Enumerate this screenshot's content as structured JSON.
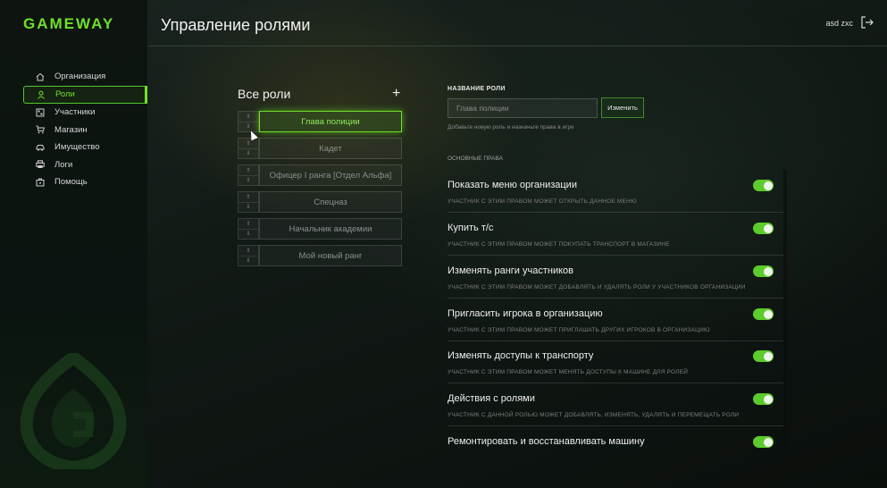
{
  "brand": {
    "logo_text": "GAMEWAY",
    "accent": "#6fe02a"
  },
  "header": {
    "title": "Управление ролями",
    "username": "asd zxc",
    "logout_icon": "logout-icon"
  },
  "sidebar": {
    "items": [
      {
        "label": "Организация",
        "icon": "home-icon",
        "active": false
      },
      {
        "label": "Роли",
        "icon": "user-icon",
        "active": true
      },
      {
        "label": "Участники",
        "icon": "members-icon",
        "active": false
      },
      {
        "label": "Магазин",
        "icon": "cart-icon",
        "active": false
      },
      {
        "label": "Имущество",
        "icon": "car-icon",
        "active": false
      },
      {
        "label": "Логи",
        "icon": "printer-icon",
        "active": false
      },
      {
        "label": "Помощь",
        "icon": "help-icon",
        "active": false
      }
    ]
  },
  "roles": {
    "title": "Все роли",
    "add_label": "+",
    "items": [
      {
        "name": "Глава полиции",
        "active": true
      },
      {
        "name": "Кадет",
        "active": false
      },
      {
        "name": "Офицер I ранга [Отдел Альфа]",
        "active": false
      },
      {
        "name": "Спецназ",
        "active": false
      },
      {
        "name": "Начальник академии",
        "active": false
      },
      {
        "name": "Мой новый ранг",
        "active": false
      }
    ]
  },
  "editor": {
    "name_label": "НАЗВАНИЕ РОЛИ",
    "name_placeholder": "Глава полиции",
    "change_label": "Изменить",
    "hint": "Добавьте новую роль и назначьте права в игре",
    "section_label": "ОСНОВНЫЕ ПРАВА",
    "permissions": [
      {
        "title": "Показать меню организации",
        "desc": "УЧАСТНИК С ЭТИМ ПРАВОМ МОЖЕТ ОТКРЫТЬ ДАННОЕ МЕНЮ",
        "enabled": true
      },
      {
        "title": "Купить т/с",
        "desc": "УЧАСТНИК С ЭТИМ ПРАВОМ МОЖЕТ ПОКУПАТЬ ТРАНСПОРТ В МАГАЗИНЕ",
        "enabled": true
      },
      {
        "title": "Изменять ранги участников",
        "desc": "УЧАСТНИК С ЭТИМ ПРАВОМ МОЖЕТ ДОБАВЛЯТЬ И УДАЛЯТЬ РОЛИ У УЧАСТНИКОВ ОРГАНИЗАЦИИ",
        "enabled": true
      },
      {
        "title": "Пригласить игрока в организацию",
        "desc": "УЧАСТНИК С ЭТИМ ПРАВОМ МОЖЕТ ПРИГЛАШАТЬ ДРУГИХ ИГРОКОВ В ОРГАНИЗАЦИЮ",
        "enabled": true
      },
      {
        "title": "Изменять доступы к транспорту",
        "desc": "УЧАСТНИК С ЭТИМ ПРАВОМ МОЖЕТ МЕНЯТЬ ДОСТУПЫ К МАШИНЕ ДЛЯ РОЛЕЙ",
        "enabled": true
      },
      {
        "title": "Действия с ролями",
        "desc": "УЧАСТНИК С ДАННОЙ РОЛЬЮ МОЖЕТ ДОБАВЛЯТЬ, ИЗМЕНЯТЬ, УДАЛЯТЬ И ПЕРЕМЕЩАТЬ РОЛИ",
        "enabled": true
      },
      {
        "title": "Ремонтировать и восстанавливать машину",
        "desc": "",
        "enabled": true
      }
    ]
  }
}
